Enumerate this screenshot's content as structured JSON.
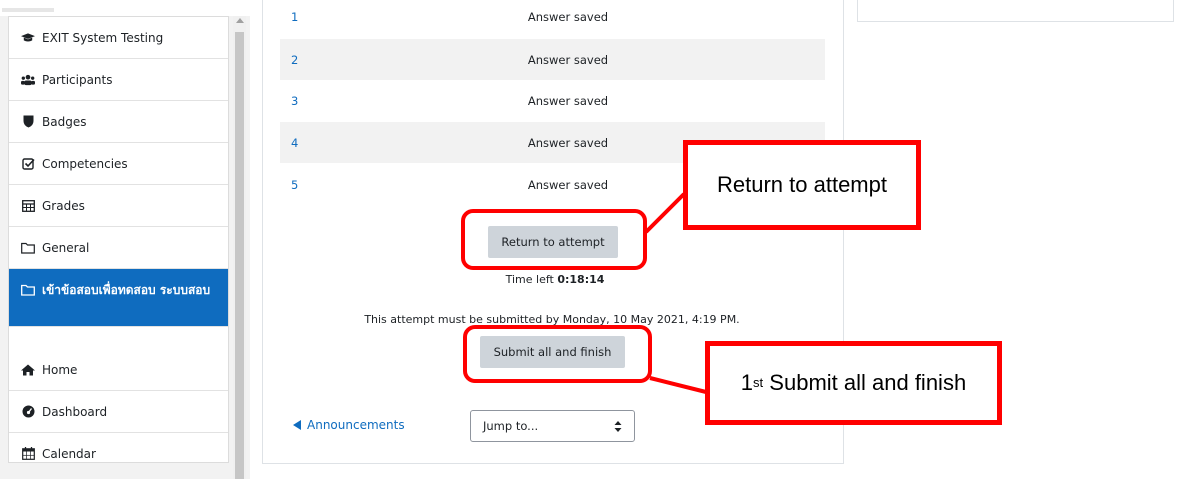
{
  "sidebar": {
    "items": [
      {
        "icon": "graduation-cap-icon",
        "label": "EXIT System Testing"
      },
      {
        "icon": "users-icon",
        "label": "Participants"
      },
      {
        "icon": "shield-icon",
        "label": "Badges"
      },
      {
        "icon": "checkbox-icon",
        "label": "Competencies"
      },
      {
        "icon": "table-icon",
        "label": "Grades"
      },
      {
        "icon": "folder-icon",
        "label": "General"
      },
      {
        "icon": "folder-icon",
        "label": "เข้าข้อสอบเพื่อทดสอบ ระบบสอบ",
        "active": true
      },
      {
        "icon": "home-icon",
        "label": "Home"
      },
      {
        "icon": "dashboard-icon",
        "label": "Dashboard"
      },
      {
        "icon": "calendar-icon",
        "label": "Calendar"
      }
    ]
  },
  "summary": {
    "rows": [
      {
        "question": "1",
        "status": "Answer saved"
      },
      {
        "question": "2",
        "status": "Answer saved"
      },
      {
        "question": "3",
        "status": "Answer saved"
      },
      {
        "question": "4",
        "status": "Answer saved"
      },
      {
        "question": "5",
        "status": "Answer saved"
      }
    ],
    "return_button": "Return to attempt",
    "time_left_label": "Time left",
    "time_left_value": "0:18:14",
    "deadline_text": "This attempt must be submitted by Monday, 10 May 2021, 4:19 PM.",
    "submit_button": "Submit all and finish"
  },
  "footer_nav": {
    "prev_link": "Announcements",
    "jump_placeholder": "Jump to..."
  },
  "annotations": {
    "callout_return": "Return to attempt",
    "callout_submit_ordinal": "1",
    "callout_submit_suffix": "st",
    "callout_submit_text": "Submit all and finish",
    "color": "#ff0000"
  },
  "colors": {
    "accent": "#0f6cbf",
    "button_bg": "#ced4da",
    "row_alt": "#f2f2f2"
  }
}
